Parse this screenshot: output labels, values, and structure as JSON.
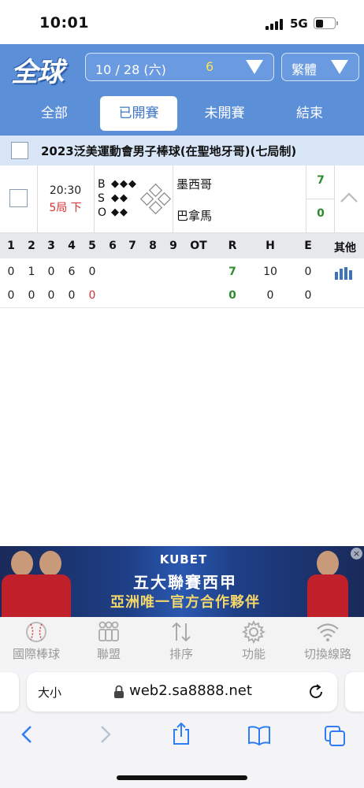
{
  "status": {
    "time": "10:01",
    "network": "5G"
  },
  "header": {
    "logo": "全球",
    "date": "10 / 28 (六)",
    "game_count": "6",
    "language": "繁體"
  },
  "tabs": [
    {
      "label": "全部",
      "active": false
    },
    {
      "label": "已開賽",
      "active": true
    },
    {
      "label": "未開賽",
      "active": false
    },
    {
      "label": "結束",
      "active": false
    }
  ],
  "league": {
    "name": "2023泛美運動會男子棒球(在聖地牙哥)(七局制)"
  },
  "game": {
    "time": "20:30",
    "inning": "5局 下",
    "bso": {
      "b": "B",
      "s": "S",
      "o": "O",
      "balls_dots": "◆◆◆",
      "strikes_dots": "◆◆",
      "outs_dots": "◆◆"
    },
    "home": {
      "name": "墨西哥",
      "score": "7"
    },
    "away": {
      "name": "巴拿馬",
      "score": "0"
    }
  },
  "linescore": {
    "headers": [
      "1",
      "2",
      "3",
      "4",
      "5",
      "6",
      "7",
      "8",
      "9",
      "OT",
      "R",
      "H",
      "E",
      "其他"
    ],
    "rows": [
      {
        "innings": [
          "0",
          "1",
          "0",
          "6",
          "0",
          "",
          "",
          "",
          "",
          ""
        ],
        "r": "7",
        "h": "10",
        "e": "0"
      },
      {
        "innings": [
          "0",
          "0",
          "0",
          "0",
          "0",
          "",
          "",
          "",
          "",
          ""
        ],
        "r": "0",
        "h": "0",
        "e": "0"
      }
    ]
  },
  "ad": {
    "brand": "KUBET",
    "line1": "五大聯賽西甲",
    "line2": "亞洲唯一官方合作夥伴"
  },
  "bottom_nav": [
    {
      "label": "國際棒球",
      "icon": "baseball-icon"
    },
    {
      "label": "聯盟",
      "icon": "league-icon"
    },
    {
      "label": "排序",
      "icon": "sort-icon"
    },
    {
      "label": "功能",
      "icon": "gear-icon"
    },
    {
      "label": "切換線路",
      "icon": "wifi-icon"
    }
  ],
  "browser": {
    "text_size": "大小",
    "url": "web2.sa8888.net"
  },
  "colors": {
    "header_blue": "#5b8fd8",
    "score_green": "#2e8b2e",
    "inning_red": "#d83030"
  }
}
